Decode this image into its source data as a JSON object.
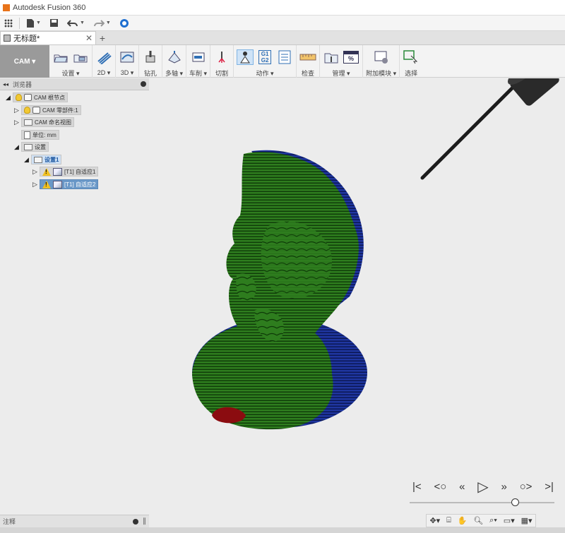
{
  "app": {
    "title": "Autodesk Fusion 360"
  },
  "document": {
    "tab_title": "无标题*",
    "close_glyph": "✕",
    "new_tab_glyph": "+"
  },
  "workspace": {
    "label": "CAM ▾"
  },
  "ribbon": {
    "groups": [
      {
        "label": "设置 ▾"
      },
      {
        "label": "2D ▾"
      },
      {
        "label": "3D ▾"
      },
      {
        "label": "钻孔"
      },
      {
        "label": "多轴 ▾"
      },
      {
        "label": "车削 ▾"
      },
      {
        "label": "切割"
      },
      {
        "label": "动作 ▾"
      },
      {
        "label": "检查"
      },
      {
        "label": "管理 ▾"
      },
      {
        "label": "附加模块 ▾"
      },
      {
        "label": "选择"
      }
    ],
    "g1g2": {
      "top": "G1",
      "bottom": "G2"
    },
    "percent": "%"
  },
  "browser": {
    "header": "浏览器",
    "nodes": [
      {
        "label": "CAM 根节点"
      },
      {
        "label": "CAM 零部件:1"
      },
      {
        "label": "CAM 命名视图"
      },
      {
        "label": "单位: mm"
      },
      {
        "label": "设置"
      },
      {
        "label": "设置1"
      },
      {
        "label": "[T1] 自适应1"
      },
      {
        "label": "[T1] 自适应2"
      }
    ]
  },
  "comments": {
    "label": "注释"
  },
  "playback": {
    "progress": 0.73
  },
  "colors": {
    "accent": "#6a98c8",
    "toolpath_green": "#2e7d1e",
    "stock_blue": "#1a2f8f",
    "warning": "#f0c020"
  }
}
